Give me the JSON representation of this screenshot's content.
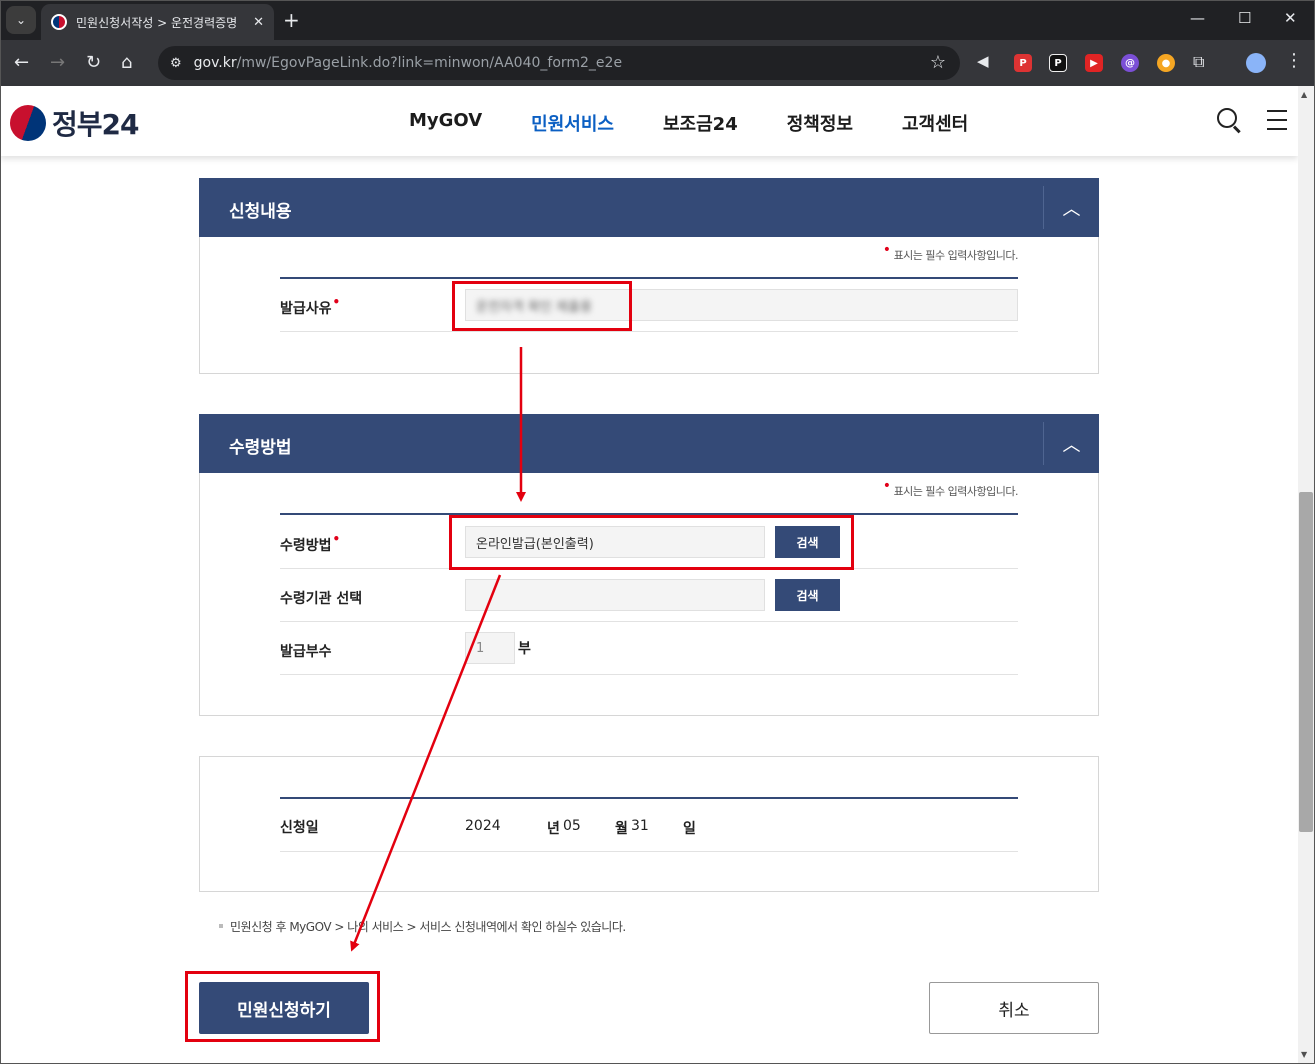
{
  "browser": {
    "tab_title": "민원신청서작성 > 운전경력증명",
    "tab_close": "✕",
    "new_tab": "+",
    "url_domain": "gov.kr",
    "url_path": "/mw/EgovPageLink.do?link=minwon/AA040_form2_e2e",
    "window_controls": [
      "—",
      "☐",
      "✕"
    ]
  },
  "site": {
    "logo_text": "정부24",
    "nav": [
      {
        "label": "MyGOV",
        "active": false
      },
      {
        "label": "민원서비스",
        "active": true
      },
      {
        "label": "보조금24",
        "active": false
      },
      {
        "label": "정책정보",
        "active": false
      },
      {
        "label": "고객센터",
        "active": false
      }
    ]
  },
  "sections": {
    "content": {
      "title": "신청내용",
      "required_note": "표시는 필수 입력사항입니다.",
      "issue_reason_label": "발급사유",
      "issue_reason_value": "운전자격 확인 제출용"
    },
    "receive": {
      "title": "수령방법",
      "required_note": "표시는 필수 입력사항입니다.",
      "method_label": "수령방법",
      "method_value": "온라인발급(본인출력)",
      "search_button": "검색",
      "agency_label": "수령기관 선택",
      "agency_value": "",
      "agency_search_button": "검색",
      "copies_label": "발급부수",
      "copies_value": "1",
      "copies_unit": "부"
    },
    "date": {
      "label": "신청일",
      "year": "2024",
      "year_unit": "년",
      "month": "05",
      "month_unit": "월",
      "day": "31",
      "day_unit": "일"
    }
  },
  "info_note": "민원신청 후 MyGOV > 나의 서비스 > 서비스 신청내역에서 확인 하실수 있습니다.",
  "buttons": {
    "submit": "민원신청하기",
    "cancel": "취소"
  },
  "colors": {
    "section_header": "#344a77",
    "annotation": "#e3000f",
    "nav_active": "#0b5fc3"
  }
}
